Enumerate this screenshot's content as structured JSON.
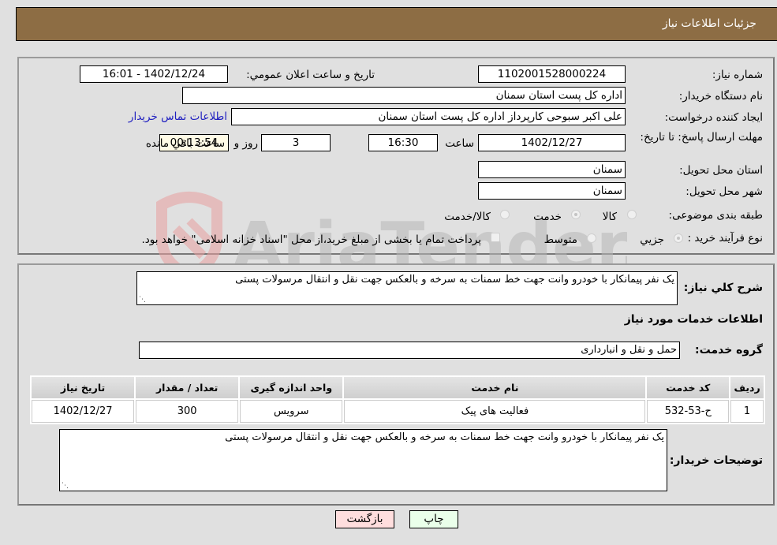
{
  "header": {
    "title": "جزئیات اطلاعات نیاز"
  },
  "form": {
    "need_number": {
      "label": "شماره نیاز:",
      "value": "1102001528000224"
    },
    "announce_datetime": {
      "label": "تاريخ و ساعت اعلان عمومي:",
      "value": "1402/12/24 - 16:01"
    },
    "buyer_org": {
      "label": "نام دستگاه خریدار:",
      "value": "اداره کل پست استان سمنان"
    },
    "requester": {
      "label": "ایجاد کننده درخواست:",
      "value": "علی اکبر سبوحی کارپرداز اداره کل پست استان سمنان"
    },
    "buyer_contact_link": "اطلاعات تماس خریدار",
    "deadline": {
      "label": "مهلت ارسال پاسخ: تا تاریخ:",
      "date": "1402/12/27",
      "time_label": "ساعت",
      "time": "16:30",
      "days": "3",
      "days_label": "روز و",
      "remaining": "00:13:54",
      "remaining_label": "ساعت باقي مانده"
    },
    "delivery_province": {
      "label": "استان محل تحویل:",
      "value": "سمنان"
    },
    "delivery_city": {
      "label": "شهر محل تحویل:",
      "value": "سمنان"
    },
    "category": {
      "label": "طبقه بندی موضوعی:",
      "options": [
        "کالا",
        "خدمت",
        "کالا/خدمت"
      ],
      "selected": "خدمت"
    },
    "purchase_process": {
      "label": "نوع فرآیند خرید :",
      "options": [
        "جزيي",
        "متوسط"
      ],
      "selected": "جزيي",
      "treasury_note": "پرداخت تمام یا بخشی از مبلغ خرید،از محل \"اسناد خزانه اسلامی\" خواهد بود."
    }
  },
  "details": {
    "summary_label": "شرح كلي نياز:",
    "summary": "یک نفر پیمانکار با خودرو وانت جهت خط سمنات به سرخه و بالعکس جهت نقل و انتقال مرسولات پستی",
    "services_heading": "اطلاعات خدمات مورد نیاز",
    "service_group_label": "گروه خدمت:",
    "service_group": "حمل و نقل و انبارداری",
    "table": {
      "headers": [
        "ردیف",
        "کد خدمت",
        "نام خدمت",
        "واحد اندازه گیری",
        "تعداد / مقدار",
        "تاریخ نیاز"
      ],
      "rows": [
        [
          "1",
          "ح-53-532",
          "فعالیت های پیک",
          "سرویس",
          "300",
          "1402/12/27"
        ]
      ]
    },
    "buyer_notes_label": "توضیحات خریدار:",
    "buyer_notes": "یک نفر پیمانکار با خودرو وانت جهت خط سمنات به سرخه و بالعکس جهت نقل و انتقال مرسولات پستی"
  },
  "buttons": {
    "print": "چاپ",
    "back": "بازگشت"
  },
  "watermark": {
    "text": "AriaTender.neT"
  },
  "colors": {
    "header_bg": "#8d6d44",
    "print_bg": "#eaffea",
    "back_bg": "#ffdede",
    "link": "#2020c0"
  }
}
